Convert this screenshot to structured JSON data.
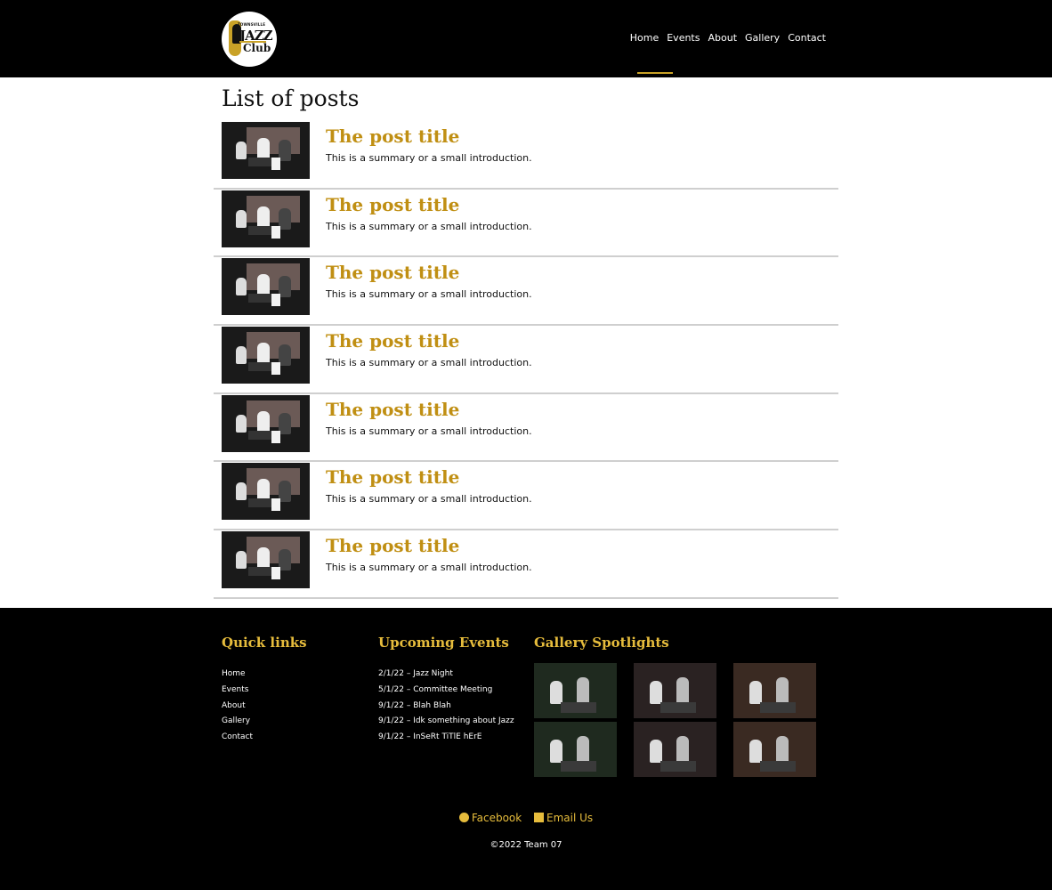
{
  "header": {
    "logo": {
      "line1": "TOWNSVILLE",
      "line2": "JAZZ",
      "line3": "Club",
      "alt": "Townsville Jazz Club logo"
    },
    "nav": [
      {
        "label": "Home"
      },
      {
        "label": "Events"
      },
      {
        "label": "About"
      },
      {
        "label": "Gallery"
      },
      {
        "label": "Contact"
      }
    ],
    "active_nav": "Home"
  },
  "main": {
    "title": "List of posts",
    "posts": [
      {
        "title": "The post title",
        "summary": "This is a summary or a small introduction."
      },
      {
        "title": "The post title",
        "summary": "This is a summary or a small introduction."
      },
      {
        "title": "The post title",
        "summary": "This is a summary or a small introduction."
      },
      {
        "title": "The post title",
        "summary": "This is a summary or a small introduction."
      },
      {
        "title": "The post title",
        "summary": "This is a summary or a small introduction."
      },
      {
        "title": "The post title",
        "summary": "This is a summary or a small introduction."
      },
      {
        "title": "The post title",
        "summary": "This is a summary or a small introduction."
      }
    ]
  },
  "footer": {
    "quick_links_title": "Quick links",
    "quick_links": [
      "Home",
      "Events",
      "About",
      "Gallery",
      "Contact"
    ],
    "events_title": "Upcoming Events",
    "events": [
      "2/1/22 – Jazz Night",
      "5/1/22 – Committee Meeting",
      "9/1/22 – Blah Blah",
      "9/1/22 – Idk something about Jazz",
      "9/1/22 – InSeRt TiTlE hErE"
    ],
    "gallery_title": "Gallery Spotlights",
    "social": [
      {
        "label": "Facebook",
        "icon": "facebook-icon"
      },
      {
        "label": "Email Us",
        "icon": "envelope-icon"
      }
    ],
    "copyright": "©2022 Team 07"
  },
  "colors": {
    "accent": "#c08f13",
    "footer_accent": "#e6bc3c",
    "header_bg": "#000000",
    "divider": "#cfcfcf"
  }
}
